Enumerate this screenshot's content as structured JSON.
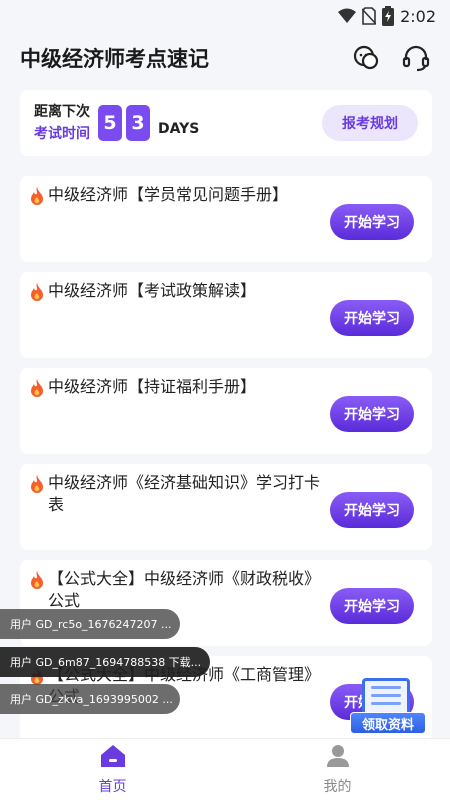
{
  "status_bar": {
    "time": "2:02"
  },
  "header": {
    "title": "中级经济师考点速记"
  },
  "countdown": {
    "label_line1": "距离下次",
    "label_line2": "考试时间",
    "digits": [
      "5",
      "3"
    ],
    "unit": "DAYS",
    "plan_button": "报考规划"
  },
  "items": [
    {
      "title": "中级经济师【学员常见问题手册】",
      "button": "开始学习"
    },
    {
      "title": "中级经济师【考试政策解读】",
      "button": "开始学习"
    },
    {
      "title": "中级经济师【持证福利手册】",
      "button": "开始学习"
    },
    {
      "title": "中级经济师《经济基础知识》学习打卡表",
      "button": "开始学习"
    },
    {
      "title": "【公式大全】中级经济师《财政税收》公式",
      "button": "开始学习"
    },
    {
      "title": "【公式大全】中级经济师《工商管理》公式",
      "button": "开始学习"
    }
  ],
  "toasts": [
    "用户 GD_rc5o_1676247207 ...",
    "用户 GD_6m87_1694788538 下载...",
    "用户 GD_zkva_1693995002 ..."
  ],
  "float_badge": {
    "label": "领取资料"
  },
  "tabbar": {
    "tabs": [
      {
        "label": "首页"
      },
      {
        "label": "我的"
      }
    ]
  },
  "colors": {
    "accent": "#6a3ce0",
    "button_gradient_top": "#8a5cf6",
    "button_gradient_bottom": "#5a2bd9"
  }
}
